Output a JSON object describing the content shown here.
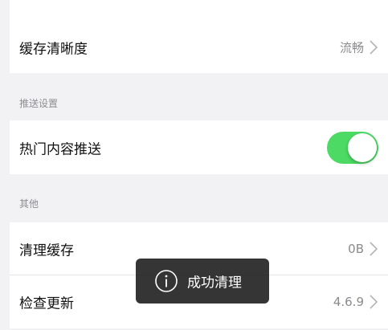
{
  "rows": {
    "cache_quality": {
      "label": "缓存清晰度",
      "value": "流畅"
    },
    "hot_push": {
      "label": "热门内容推送",
      "enabled": true
    },
    "clear_cache": {
      "label": "清理缓存",
      "value": "0B"
    },
    "check_update": {
      "label": "检查更新",
      "value": "4.6.9"
    }
  },
  "sections": {
    "push": "推送设置",
    "other": "其他"
  },
  "toast": {
    "text": "成功清理",
    "icon": "info-icon"
  },
  "colors": {
    "background": "#f2f2f4",
    "toggle_on": "#4cd964",
    "toast_bg": "#141414"
  }
}
